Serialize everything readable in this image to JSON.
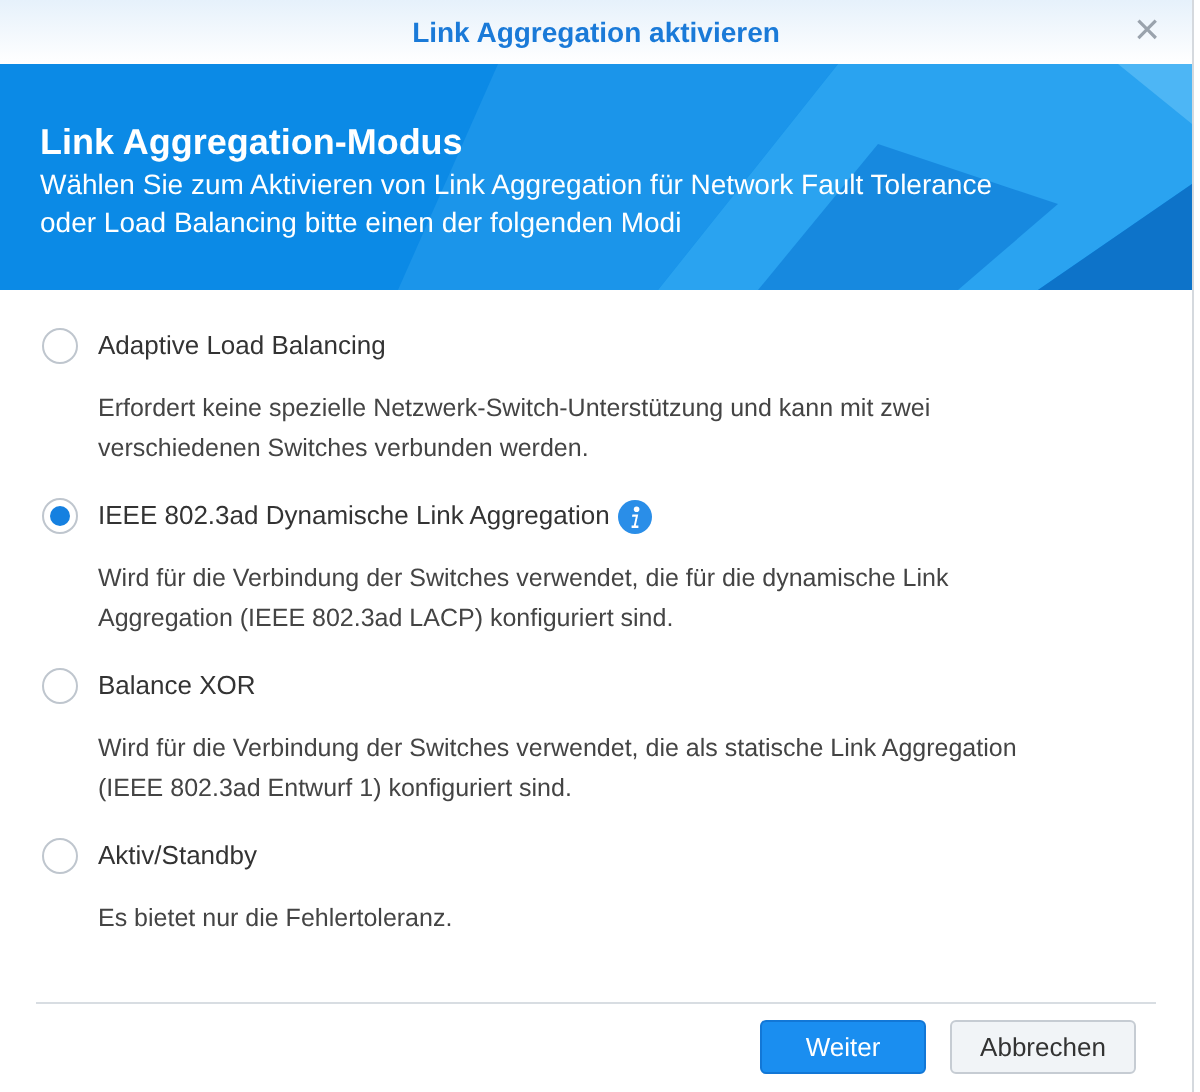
{
  "window": {
    "title": "Link Aggregation aktivieren",
    "close": "×"
  },
  "header": {
    "title": "Link Aggregation-Modus",
    "subtitle": "Wählen Sie zum Aktivieren von Link Aggregation für Network Fault Tolerance oder Load Balancing bitte einen der folgenden Modi"
  },
  "options": [
    {
      "label": "Adaptive Load Balancing",
      "selected": false,
      "info": false,
      "description": "Erfordert keine spezielle Netzwerk-Switch-Unterstützung und kann mit zwei verschiedenen Switches verbunden werden."
    },
    {
      "label": "IEEE 802.3ad Dynamische Link Aggregation",
      "selected": true,
      "info": true,
      "description": "Wird für die Verbindung der Switches verwendet, die für die dynamische Link Aggregation (IEEE 802.3ad LACP) konfiguriert sind."
    },
    {
      "label": "Balance XOR",
      "selected": false,
      "info": false,
      "description": "Wird für die Verbindung der Switches verwendet, die als statische Link Aggregation (IEEE 802.3ad Entwurf 1) konfiguriert sind."
    },
    {
      "label": "Aktiv/Standby",
      "selected": false,
      "info": false,
      "description": "Es bietet nur die Fehlertoleranz."
    }
  ],
  "buttons": [
    {
      "label": "Weiter",
      "kind": "primary"
    },
    {
      "label": "Abbrechen",
      "kind": "secondary"
    }
  ]
}
